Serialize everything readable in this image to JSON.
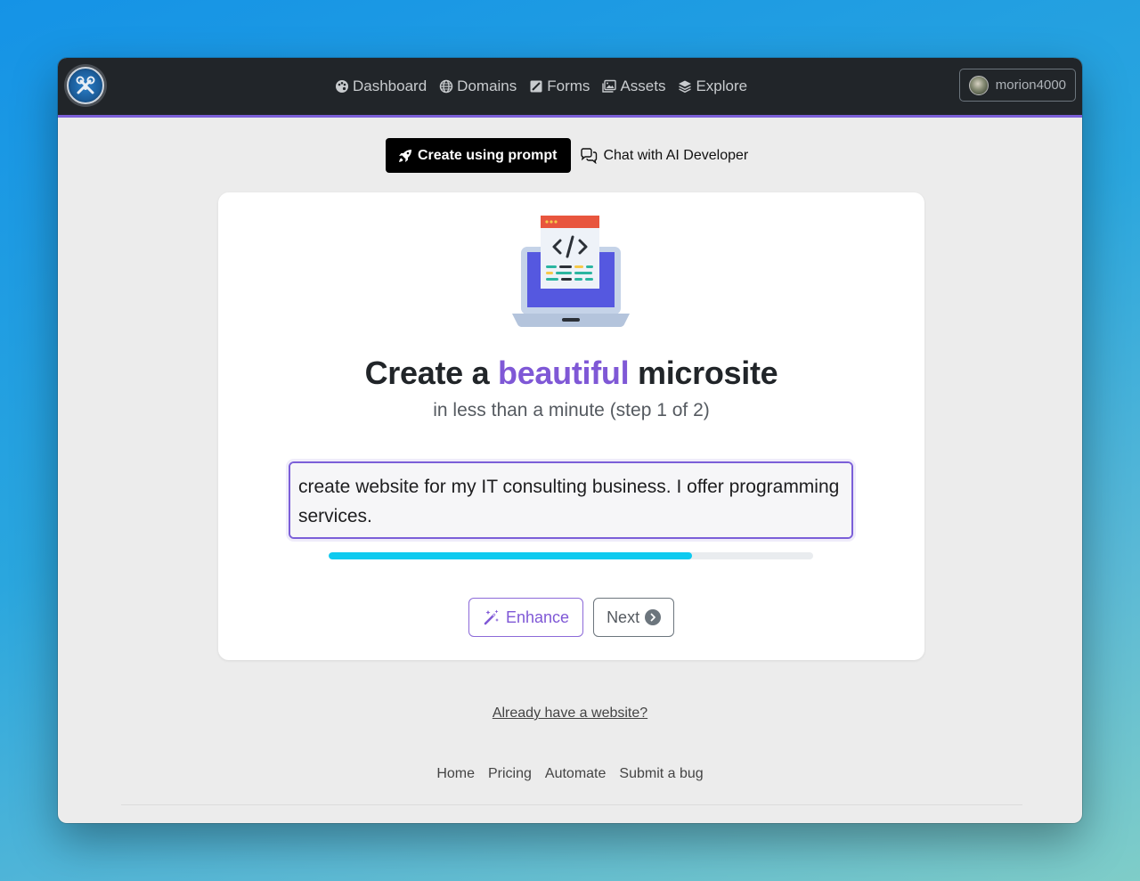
{
  "navbar": {
    "links": [
      {
        "label": "Dashboard",
        "icon": "palette-icon"
      },
      {
        "label": "Domains",
        "icon": "globe-icon"
      },
      {
        "label": "Forms",
        "icon": "form-icon"
      },
      {
        "label": "Assets",
        "icon": "images-icon"
      },
      {
        "label": "Explore",
        "icon": "layers-icon"
      }
    ],
    "user": {
      "name": "morion4000"
    }
  },
  "tabs": {
    "create_label": "Create using prompt",
    "chat_label": "Chat with AI Developer"
  },
  "hero": {
    "title_before": "Create a ",
    "title_accent": "beautiful",
    "title_after": " microsite",
    "subtitle": "in less than a minute (step 1 of 2)"
  },
  "prompt": {
    "value": "create website for my IT consulting business. I offer programming services."
  },
  "progress": {
    "percent": 75
  },
  "actions": {
    "enhance_label": "Enhance",
    "next_label": "Next"
  },
  "links": {
    "already_label": "Already have a website?"
  },
  "footer": {
    "links": [
      "Home",
      "Pricing",
      "Automate",
      "Submit a bug"
    ]
  },
  "colors": {
    "accent": "#7f58d6",
    "navbar": "#212529",
    "progress": "#0dcaf0"
  }
}
